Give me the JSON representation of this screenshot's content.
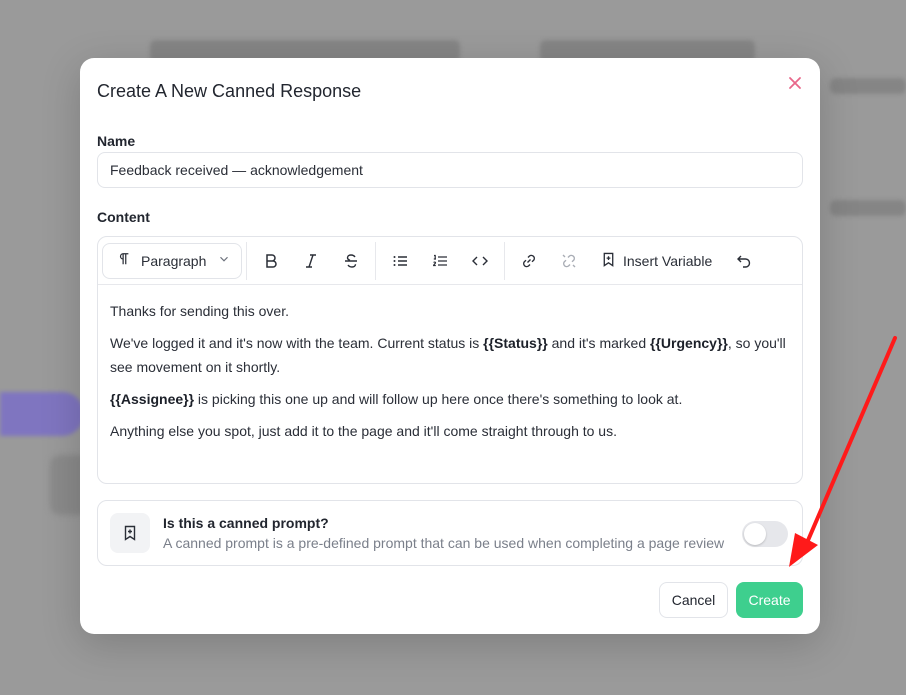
{
  "modal": {
    "title": "Create A New Canned Response",
    "name_label": "Name",
    "name_value": "Feedback received — acknowledgement",
    "content_label": "Content",
    "toolbar": {
      "paragraph_select": "Paragraph",
      "insert_variable": "Insert Variable",
      "icons": [
        "paragraph-icon",
        "chevron-down-icon",
        "bold-icon",
        "italic-icon",
        "strikethrough-icon",
        "bullet-list-icon",
        "ordered-list-icon",
        "code-icon",
        "link-icon",
        "unlink-icon",
        "bookmark-plus-icon",
        "undo-icon"
      ]
    },
    "content": {
      "p1": "Thanks for sending this over.",
      "p2_a": "We've logged it and it's now with the team. Current status is ",
      "p2_var1": "{{Status}}",
      "p2_b": " and it's marked ",
      "p2_var2": "{{Urgency}}",
      "p2_c": ", so you'll see movement on it shortly.",
      "p3_var": "{{Assignee}}",
      "p3_rest": " is picking this one up and will follow up here once there's something to look at.",
      "p4": "Anything else you spot, just add it to the page and it'll come straight through to us."
    },
    "canned_prompt": {
      "title": "Is this a canned prompt?",
      "description": "A canned prompt is a pre-defined prompt that can be used when completing a page review",
      "toggle_on": false
    },
    "buttons": {
      "cancel": "Cancel",
      "create": "Create"
    }
  },
  "colors": {
    "accent_green": "#3ecf8e",
    "close_pink": "#e8678a",
    "arrow_red": "#ff1a1a"
  }
}
